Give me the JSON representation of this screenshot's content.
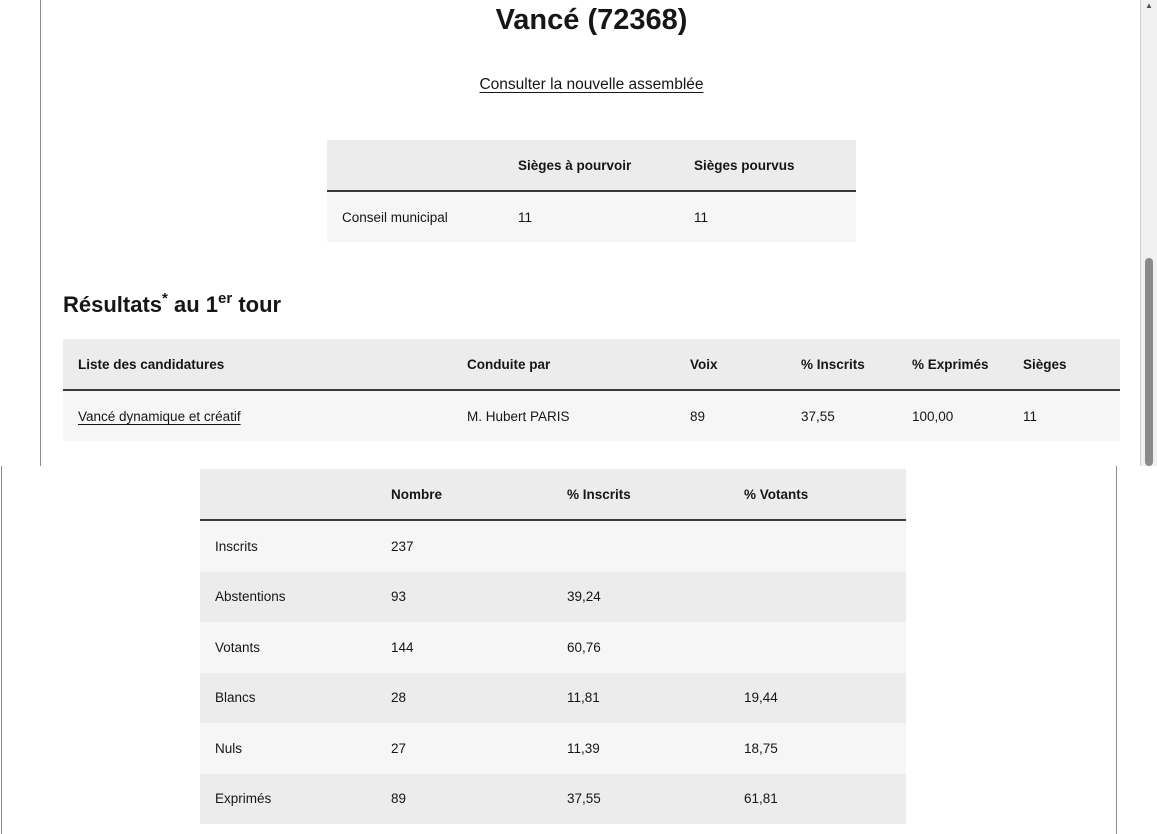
{
  "page": {
    "title": "Vancé (72368)",
    "assembly_link": "Consulter la nouvelle assemblée"
  },
  "seats_table": {
    "headers": [
      "",
      "Sièges à pourvoir",
      "Sièges pourvus"
    ],
    "row": {
      "label": "Conseil municipal",
      "to_fill": "11",
      "filled": "11"
    }
  },
  "results": {
    "heading_main": "Résultats",
    "heading_star": "*",
    "heading_mid": " au 1",
    "heading_sup": "er",
    "heading_end": " tour",
    "headers": [
      "Liste des candidatures",
      "Conduite par",
      "Voix",
      "% Inscrits",
      "% Exprimés",
      "Sièges"
    ],
    "row": {
      "list": "Vancé dynamique et créatif",
      "leader": "M. Hubert PARIS",
      "votes": "89",
      "pct_registered": "37,55",
      "pct_expressed": "100,00",
      "seats": "11"
    }
  },
  "stats_table": {
    "headers": [
      "",
      "Nombre",
      "% Inscrits",
      "% Votants"
    ],
    "rows": [
      {
        "label": "Inscrits",
        "number": "237",
        "pct_registered": "",
        "pct_voters": ""
      },
      {
        "label": "Abstentions",
        "number": "93",
        "pct_registered": "39,24",
        "pct_voters": ""
      },
      {
        "label": "Votants",
        "number": "144",
        "pct_registered": "60,76",
        "pct_voters": ""
      },
      {
        "label": "Blancs",
        "number": "28",
        "pct_registered": "11,81",
        "pct_voters": "19,44"
      },
      {
        "label": "Nuls",
        "number": "27",
        "pct_registered": "11,39",
        "pct_voters": "18,75"
      },
      {
        "label": "Exprimés",
        "number": "89",
        "pct_registered": "37,55",
        "pct_voters": "61,81"
      }
    ]
  },
  "scrollbar": {
    "up_icon": "triangle-up"
  }
}
